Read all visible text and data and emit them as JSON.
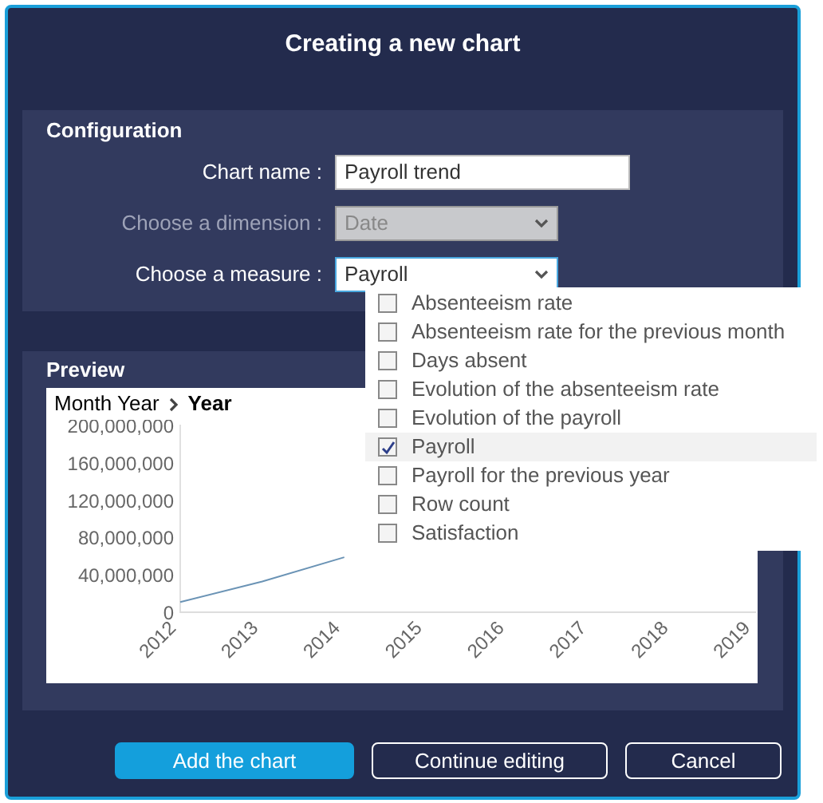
{
  "dialog": {
    "title": "Creating a new chart"
  },
  "configuration": {
    "heading": "Configuration",
    "fields": [
      {
        "kind": "text",
        "label": "Chart name :",
        "value": "Payroll trend",
        "disabled": false,
        "focused": false
      },
      {
        "kind": "select",
        "label": "Choose a dimension :",
        "value": "Date",
        "disabled": true,
        "focused": false
      },
      {
        "kind": "select",
        "label": "Choose a measure :",
        "value": "Payroll",
        "disabled": false,
        "focused": true
      }
    ]
  },
  "measure_dropdown": {
    "options": [
      {
        "label": "Absenteeism rate",
        "checked": false,
        "selected": false
      },
      {
        "label": "Absenteeism rate for the previous month",
        "checked": false,
        "selected": false
      },
      {
        "label": "Days absent",
        "checked": false,
        "selected": false
      },
      {
        "label": "Evolution of the absenteeism rate",
        "checked": false,
        "selected": false
      },
      {
        "label": "Evolution of the payroll",
        "checked": false,
        "selected": false
      },
      {
        "label": "Payroll",
        "checked": true,
        "selected": true
      },
      {
        "label": "Payroll for the previous year",
        "checked": false,
        "selected": false
      },
      {
        "label": "Row count",
        "checked": false,
        "selected": false
      },
      {
        "label": "Satisfaction",
        "checked": false,
        "selected": false
      }
    ]
  },
  "preview": {
    "heading": "Preview",
    "breadcrumb": [
      {
        "label": "Month Year",
        "current": false
      },
      {
        "label": "Year",
        "current": true
      }
    ],
    "chart_data": {
      "type": "line",
      "categories": [
        "2012",
        "2013",
        "2014",
        "2015",
        "2016",
        "2017",
        "2018",
        "2019"
      ],
      "series": [
        {
          "color": "#6a93b5",
          "values": [
            10000000,
            32000000,
            58000000,
            null,
            null,
            null,
            null,
            null
          ]
        }
      ],
      "yticks": [
        {
          "value": 0,
          "label": "0"
        },
        {
          "value": 40000000,
          "label": "40,000,000"
        },
        {
          "value": 80000000,
          "label": "80,000,000"
        },
        {
          "value": 120000000,
          "label": "120,000,000"
        },
        {
          "value": 160000000,
          "label": "160,000,000"
        },
        {
          "value": 200000000,
          "label": "200,000,000"
        }
      ],
      "ylim": [
        0,
        200000000
      ]
    }
  },
  "buttons": [
    {
      "label": "Add the chart",
      "kind": "primary"
    },
    {
      "label": "Continue editing",
      "kind": "outline"
    },
    {
      "label": "Cancel",
      "kind": "outline"
    }
  ]
}
